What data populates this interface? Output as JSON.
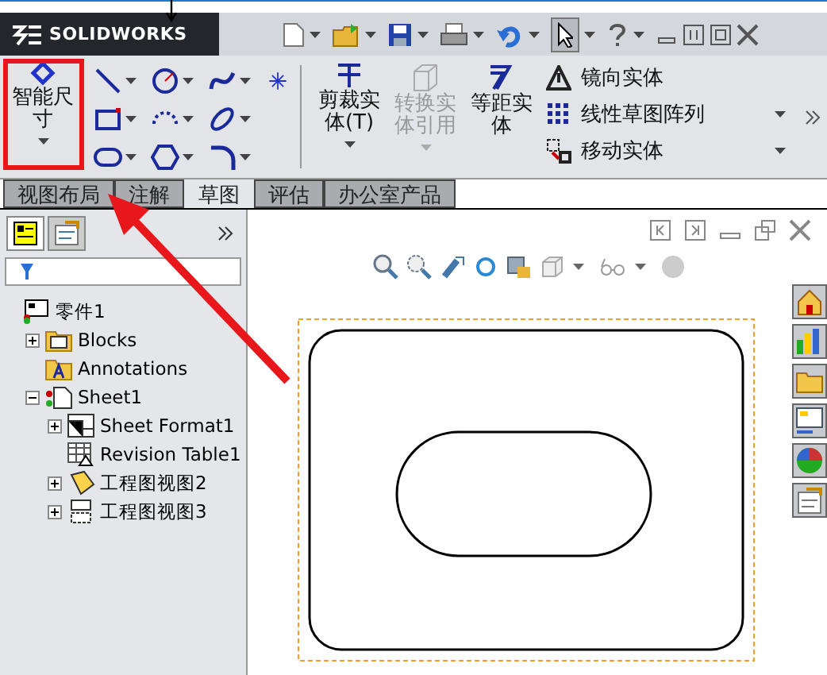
{
  "app": {
    "logo": "SOLIDWORKS"
  },
  "ribbon": {
    "smart_dimension": {
      "label": "智能尺寸",
      "highlighted": true
    },
    "big_tools": [
      {
        "kind": "trim",
        "label": "剪裁实体(T)",
        "disabled": false
      },
      {
        "kind": "convert",
        "label": "转换实体引用",
        "disabled": true
      },
      {
        "kind": "offset",
        "label": "等距实体",
        "disabled": false
      }
    ],
    "list_tools": [
      {
        "kind": "mirror",
        "label": "镜向实体",
        "dropdown": false
      },
      {
        "kind": "pattern",
        "label": "线性草图阵列",
        "dropdown": true
      },
      {
        "kind": "move",
        "label": "移动实体",
        "dropdown": true
      }
    ]
  },
  "tabs": [
    {
      "label": "视图布局",
      "selected": false
    },
    {
      "label": "注解",
      "selected": false
    },
    {
      "label": "草图",
      "selected": true
    },
    {
      "label": "评估",
      "selected": false
    },
    {
      "label": "办公室产品",
      "selected": false
    }
  ],
  "tree": [
    {
      "kind": "part",
      "label": "零件1",
      "children": [
        {
          "kind": "blocks",
          "label": "Blocks",
          "expanded": false
        },
        {
          "kind": "annotations",
          "label": "Annotations"
        },
        {
          "kind": "sheet",
          "label": "Sheet1",
          "expanded": true,
          "children": [
            {
              "kind": "format",
              "label": "Sheet Format1",
              "expanded": false
            },
            {
              "kind": "table",
              "label": "Revision Table1"
            },
            {
              "kind": "view",
              "label": "工程图视图2",
              "expanded": false
            },
            {
              "kind": "view2",
              "label": "工程图视图3",
              "expanded": false
            }
          ]
        }
      ]
    }
  ]
}
